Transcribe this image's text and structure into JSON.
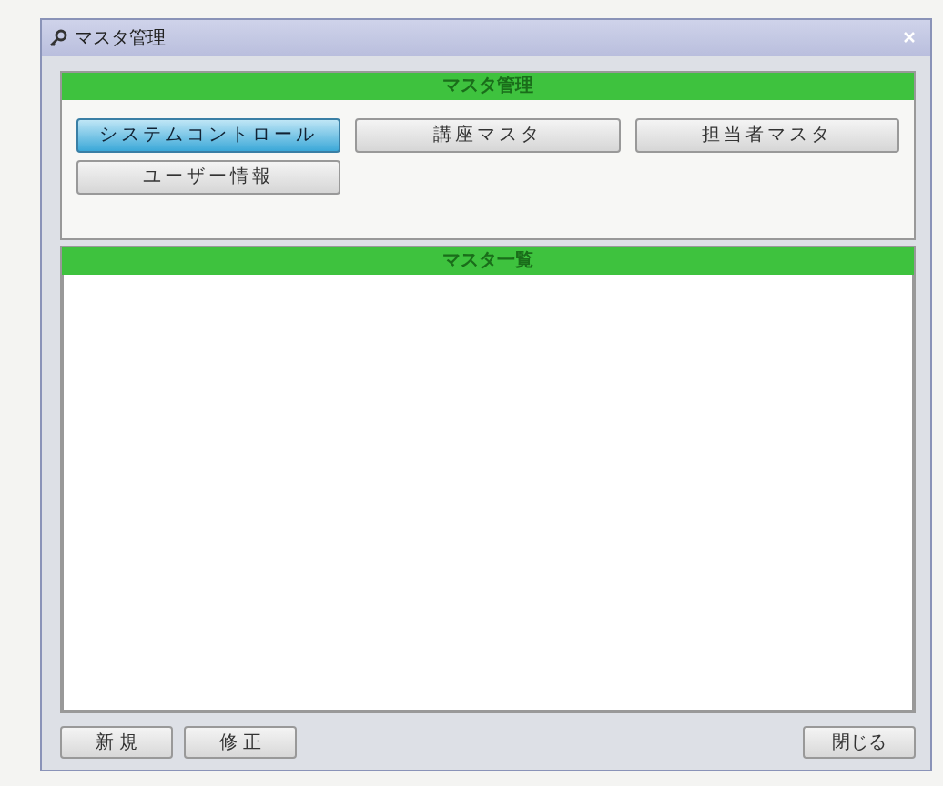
{
  "window": {
    "title": "マスタ管理"
  },
  "master_panel": {
    "title": "マスタ管理",
    "buttons": [
      {
        "label": "システムコントロール",
        "selected": true
      },
      {
        "label": "講座マスタ",
        "selected": false
      },
      {
        "label": "担当者マスタ",
        "selected": false
      },
      {
        "label": "ユーザー情報",
        "selected": false
      }
    ]
  },
  "list_panel": {
    "title": "マスタ一覧"
  },
  "footer_left_buttons": [
    "新 規",
    "修 正"
  ],
  "footer_right_buttons": [
    "閉じる"
  ]
}
